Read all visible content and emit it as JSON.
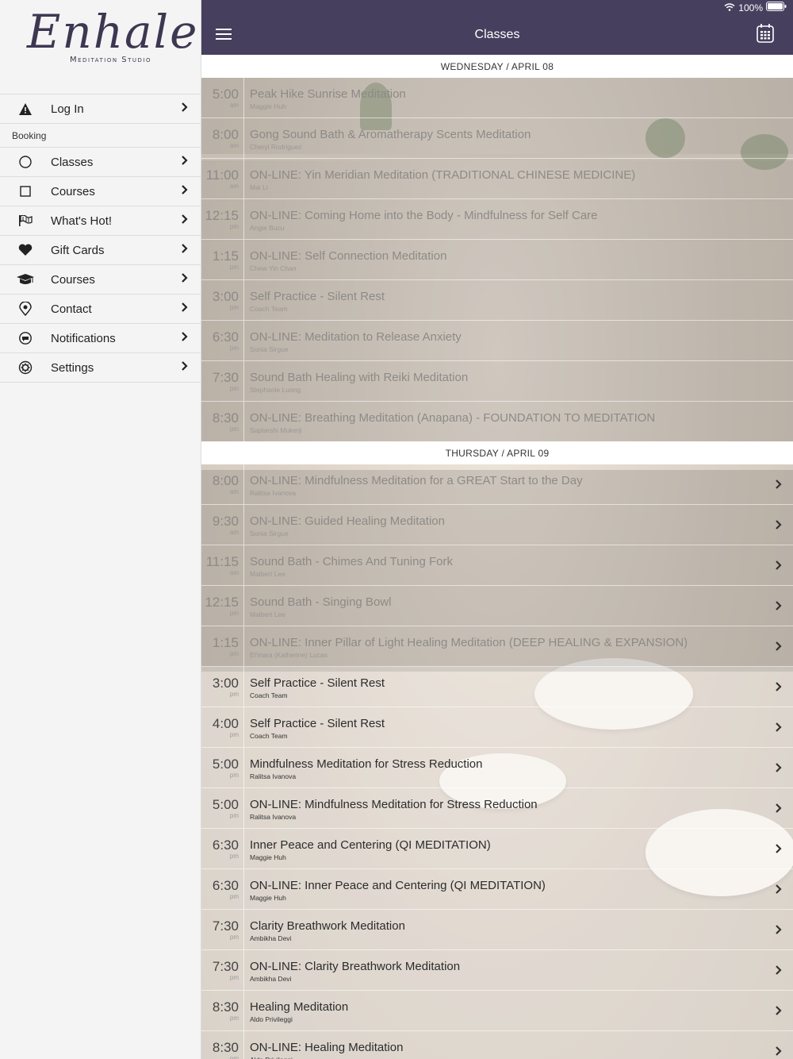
{
  "status": {
    "battery": "100%"
  },
  "logo": {
    "script": "Enhale",
    "sub": "Meditation Studio"
  },
  "sidebar": {
    "login": "Log In",
    "section": "Booking",
    "items": [
      {
        "label": "Classes",
        "icon": "circle-icon"
      },
      {
        "label": "Courses",
        "icon": "square-icon"
      },
      {
        "label": "What's Hot!",
        "icon": "flag-icon"
      },
      {
        "label": "Gift Cards",
        "icon": "heart-icon"
      },
      {
        "label": "Courses",
        "icon": "graduation-cap-icon"
      },
      {
        "label": "Contact",
        "icon": "location-pin-icon"
      },
      {
        "label": "Notifications",
        "icon": "chat-bubble-icon"
      },
      {
        "label": "Settings",
        "icon": "gear-icon"
      }
    ]
  },
  "navbar": {
    "title": "Classes"
  },
  "days": [
    {
      "header": "WEDNESDAY / APRIL 08",
      "classes": [
        {
          "time": "5:00",
          "ampm": "am",
          "title": "Peak Hike Sunrise Meditation",
          "instructor": "Maggie Huh"
        },
        {
          "time": "8:00",
          "ampm": "am",
          "title": "Gong Sound Bath & Aromatherapy Scents Meditation",
          "instructor": "Cheryl Rodriguez"
        },
        {
          "time": "11:00",
          "ampm": "am",
          "title": "ON-LINE: Yin Meridian Meditation (TRADITIONAL CHINESE MEDICINE)",
          "instructor": "Mai Li"
        },
        {
          "time": "12:15",
          "ampm": "pm",
          "title": "ON-LINE: Coming Home into the Body - Mindfulness for Self Care",
          "instructor": "Angie Bucu"
        },
        {
          "time": "1:15",
          "ampm": "pm",
          "title": "ON-LINE: Self Connection Meditation",
          "instructor": "Chew Yin Chan"
        },
        {
          "time": "3:00",
          "ampm": "pm",
          "title": "Self Practice - Silent Rest",
          "instructor": "Coach Team"
        },
        {
          "time": "6:30",
          "ampm": "pm",
          "title": "ON-LINE: Meditation to Release Anxiety",
          "instructor": "Sonia Sirgue"
        },
        {
          "time": "7:30",
          "ampm": "pm",
          "title": "Sound Bath Healing with Reiki Meditation",
          "instructor": "Stephanie Luong"
        },
        {
          "time": "8:30",
          "ampm": "pm",
          "title": "ON-LINE: Breathing Meditation (Anapana) - FOUNDATION TO MEDITATION",
          "instructor": "Saptarshi Mukerji"
        }
      ]
    },
    {
      "header": "THURSDAY / APRIL 09",
      "classes": [
        {
          "time": "8:00",
          "ampm": "am",
          "title": "ON-LINE: Mindfulness Meditation for a GREAT Start to the Day",
          "instructor": "Ralitsa Ivanova"
        },
        {
          "time": "9:30",
          "ampm": "am",
          "title": "ON-LINE: Guided Healing Meditation",
          "instructor": "Sonia Sirgue"
        },
        {
          "time": "11:15",
          "ampm": "am",
          "title": "Sound Bath - Chimes And Tuning Fork",
          "instructor": "Malbert Lee"
        },
        {
          "time": "12:15",
          "ampm": "pm",
          "title": "Sound Bath - Singing Bowl",
          "instructor": "Malbert Lee"
        },
        {
          "time": "1:15",
          "ampm": "pm",
          "title": "ON-LINE: Inner Pillar of Light Healing Meditation (DEEP HEALING & EXPANSION)",
          "instructor": "El'mara (Katherine) Lucas"
        },
        {
          "time": "3:00",
          "ampm": "pm",
          "title": "Self Practice - Silent Rest",
          "instructor": "Coach Team"
        },
        {
          "time": "4:00",
          "ampm": "pm",
          "title": "Self Practice - Silent Rest",
          "instructor": "Coach Team"
        },
        {
          "time": "5:00",
          "ampm": "pm",
          "title": "Mindfulness Meditation for Stress Reduction",
          "instructor": "Ralitsa Ivanova"
        },
        {
          "time": "5:00",
          "ampm": "pm",
          "title": "ON-LINE: Mindfulness Meditation for Stress Reduction",
          "instructor": "Ralitsa Ivanova"
        },
        {
          "time": "6:30",
          "ampm": "pm",
          "title": "Inner Peace and Centering  (QI MEDITATION)",
          "instructor": "Maggie Huh"
        },
        {
          "time": "6:30",
          "ampm": "pm",
          "title": "ON-LINE: Inner Peace and Centering  (QI MEDITATION)",
          "instructor": "Maggie Huh"
        },
        {
          "time": "7:30",
          "ampm": "pm",
          "title": "Clarity Breathwork Meditation",
          "instructor": "Ambikha Devi"
        },
        {
          "time": "7:30",
          "ampm": "pm",
          "title": "ON-LINE: Clarity Breathwork Meditation",
          "instructor": "Ambikha Devi"
        },
        {
          "time": "8:30",
          "ampm": "pm",
          "title": "Healing Meditation",
          "instructor": "Aldo Privileggi"
        },
        {
          "time": "8:30",
          "ampm": "pm",
          "title": "ON-LINE: Healing Meditation",
          "instructor": "Aldo Privileggi"
        }
      ]
    }
  ],
  "colors": {
    "navbar": "#463f5e",
    "sidebar": "#f4f4f4"
  }
}
